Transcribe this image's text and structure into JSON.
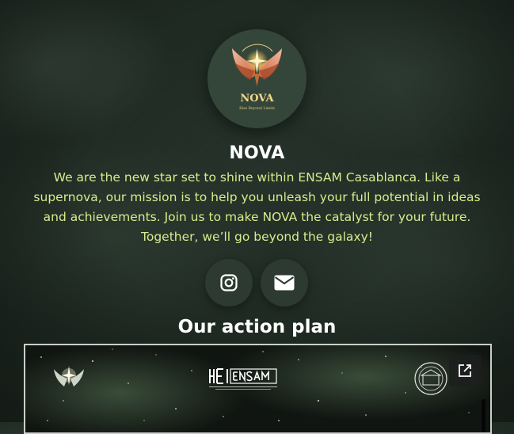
{
  "profile": {
    "logo_name": "NOVA",
    "logo_tagline": "Rise Beyond Limits",
    "name": "NOVA",
    "description": "We are the new star set to shine within ENSAM Casablanca. Like a supernova, our mission is to help you unleash your full potential in ideas and achievements. Join us to make NOVA the catalyst for your future. Together, we’ll go beyond the galaxy!"
  },
  "social": [
    {
      "icon": "instagram-icon"
    },
    {
      "icon": "envelope-icon"
    }
  ],
  "section": {
    "title": "Our action plan"
  },
  "embed": {
    "header_logo_text": "ENSAM",
    "header_logo_subtitle": "ÉCOLE NATIONALE SUPÉRIEURE D'ARTS ET MÉTIERS",
    "header_logo_subtitle2": "UNIVERSITÉ HASSAN II DE CASABLANCA",
    "open_icon": "open-external-icon"
  },
  "colors": {
    "background": "#1f2a23",
    "accent_text": "#d8ec8c",
    "avatar_bg": "#34463a",
    "button_bg": "#2d3a31"
  }
}
